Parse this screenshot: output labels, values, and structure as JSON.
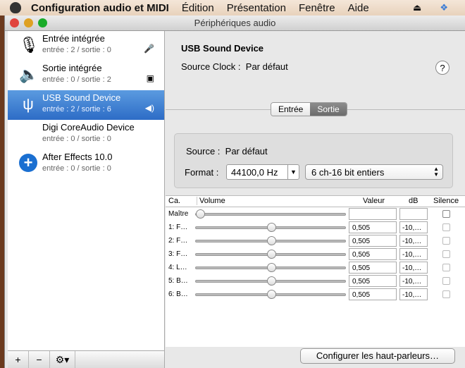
{
  "menubar": {
    "app": "Configuration audio et MIDI",
    "items": [
      "Édition",
      "Présentation",
      "Fenêtre",
      "Aide"
    ]
  },
  "window": {
    "title": "Périphériques audio"
  },
  "devices": [
    {
      "name": "Entrée intégrée",
      "io": "entrée : 2 / sortie : 0",
      "icon": "microphone-icon"
    },
    {
      "name": "Sortie intégrée",
      "io": "entrée : 0 / sortie : 2",
      "icon": "speaker-icon"
    },
    {
      "name": "USB Sound Device",
      "io": "entrée : 2 / sortie : 6",
      "icon": "usb-icon",
      "selected": true
    },
    {
      "name": "Digi CoreAudio Device",
      "io": "entrée : 0 / sortie : 0"
    },
    {
      "name": "After Effects 10.0",
      "io": "entrée : 0 / sortie : 0",
      "icon": "plus-circle-icon"
    }
  ],
  "toolbar": {
    "add": "+",
    "remove": "−",
    "gear": "⚙▾"
  },
  "detail": {
    "title": "USB Sound Device",
    "source_clock_label": "Source Clock :",
    "source_clock": "Par défaut",
    "help": "?",
    "tabs": [
      "Entrée",
      "Sortie"
    ],
    "active_tab": "Sortie",
    "source_label": "Source :",
    "source": "Par défaut",
    "format_label": "Format :",
    "rate": "44100,0 Hz",
    "format": "6 ch-16 bit entiers"
  },
  "table": {
    "headers": [
      "Ca.",
      "Volume",
      "Valeur",
      "dB",
      "Silence"
    ],
    "rows": [
      {
        "label": "Maître",
        "volume": 0,
        "value": "",
        "db": ""
      },
      {
        "label": "1: F…",
        "volume": 0.505,
        "value": "0,505",
        "db": "-10,…"
      },
      {
        "label": "2: F…",
        "volume": 0.505,
        "value": "0,505",
        "db": "-10,…"
      },
      {
        "label": "3: F…",
        "volume": 0.505,
        "value": "0,505",
        "db": "-10,…"
      },
      {
        "label": "4: L…",
        "volume": 0.505,
        "value": "0,505",
        "db": "-10,…"
      },
      {
        "label": "5: B…",
        "volume": 0.505,
        "value": "0,505",
        "db": "-10,…"
      },
      {
        "label": "6: B…",
        "volume": 0.505,
        "value": "0,505",
        "db": "-10,…"
      }
    ]
  },
  "configure_button": "Configurer les haut-parleurs…"
}
